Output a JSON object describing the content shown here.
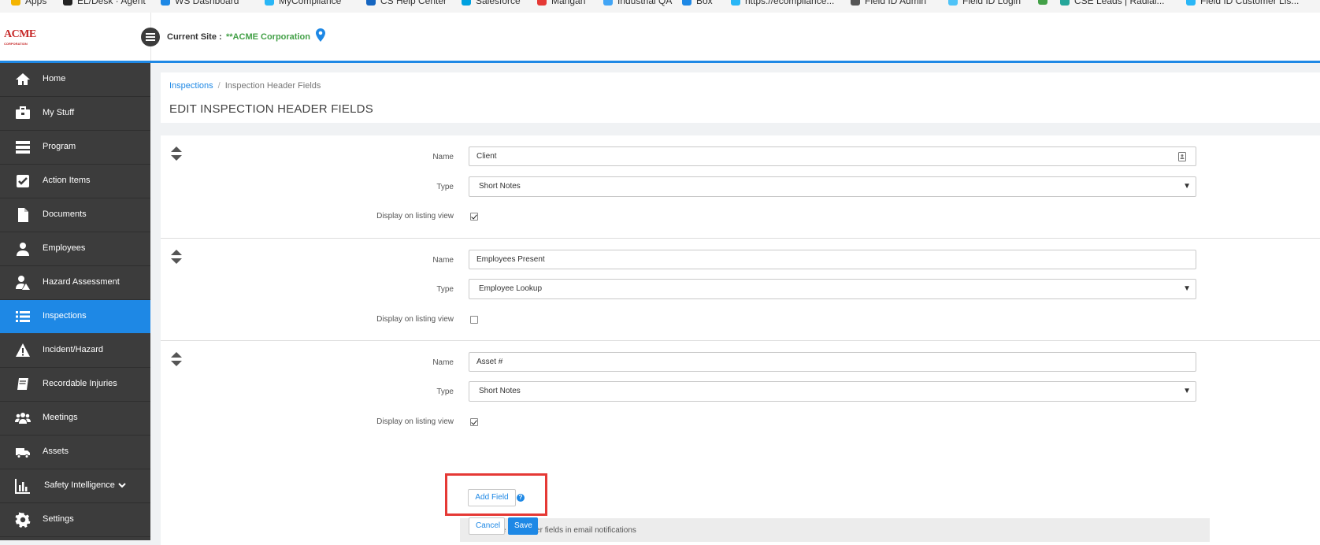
{
  "bookmarks": [
    {
      "label": "Apps",
      "color": "#f4b400"
    },
    {
      "label": "EL/Desk · Agent",
      "color": "#222222"
    },
    {
      "label": "WS Dashboard",
      "color": "#1e88e5"
    },
    {
      "label": "MyCompliance",
      "color": "#29b6f6"
    },
    {
      "label": "CS Help Center",
      "color": "#1565c0"
    },
    {
      "label": "Salesforce",
      "color": "#00a1e0"
    },
    {
      "label": "Mangan",
      "color": "#e53935"
    },
    {
      "label": "Industrial QA",
      "color": "#42a5f5"
    },
    {
      "label": "Box",
      "color": "#1e88e5"
    },
    {
      "label": "https://ecompliance...",
      "color": "#29b6f6"
    },
    {
      "label": "Field ID Admin",
      "color": "#555555"
    },
    {
      "label": "Field ID Login",
      "color": "#4fc3f7"
    },
    {
      "label": "",
      "color": "#43a047"
    },
    {
      "label": "CSE Leads | Radial...",
      "color": "#26a69a"
    },
    {
      "label": "Field ID Customer Lis...",
      "color": "#29b6f6"
    }
  ],
  "header": {
    "logo_text": "ACME",
    "logo_sub": "CORPORATION",
    "current_site_label": "Current Site :",
    "current_site_value": "**ACME Corporation"
  },
  "sidebar": {
    "items": [
      {
        "label": "Home",
        "icon": "home-icon"
      },
      {
        "label": "My Stuff",
        "icon": "briefcase-icon"
      },
      {
        "label": "Program",
        "icon": "server-icon"
      },
      {
        "label": "Action Items",
        "icon": "checkbox-icon"
      },
      {
        "label": "Documents",
        "icon": "document-icon"
      },
      {
        "label": "Employees",
        "icon": "user-icon"
      },
      {
        "label": "Hazard Assessment",
        "icon": "hazard-user-icon"
      },
      {
        "label": "Inspections",
        "icon": "list-icon",
        "active": true
      },
      {
        "label": "Incident/Hazard",
        "icon": "warning-icon"
      },
      {
        "label": "Recordable Injuries",
        "icon": "book-icon"
      },
      {
        "label": "Meetings",
        "icon": "group-icon"
      },
      {
        "label": "Assets",
        "icon": "truck-icon"
      },
      {
        "label": "Safety Intelligence",
        "icon": "bar-chart-icon",
        "has_submenu": true
      },
      {
        "label": "Settings",
        "icon": "gear-icon"
      }
    ]
  },
  "breadcrumb": {
    "parent": "Inspections",
    "separator": "/",
    "current": "Inspection Header Fields"
  },
  "page": {
    "title": "EDIT INSPECTION HEADER FIELDS"
  },
  "form": {
    "labels": {
      "name": "Name",
      "type": "Type",
      "display": "Display on listing view"
    },
    "fields": [
      {
        "name": "Client",
        "type": "Short Notes",
        "display_on_listing": true
      },
      {
        "name": "Employees Present",
        "type": "Employee Lookup",
        "display_on_listing": false
      },
      {
        "name": "Asset #",
        "type": "Short Notes",
        "display_on_listing": true
      }
    ],
    "email_notifications_label": "Include all header fields in email notifications",
    "email_notifications_checked": false,
    "add_field_label": "Add Field",
    "help_glyph": "?",
    "cancel_label": "Cancel",
    "save_label": "Save"
  },
  "colors": {
    "accent": "#1e88e5",
    "sidebar_bg": "#3c3c3c",
    "site_green": "#43a047",
    "highlight_red": "#e53935"
  }
}
